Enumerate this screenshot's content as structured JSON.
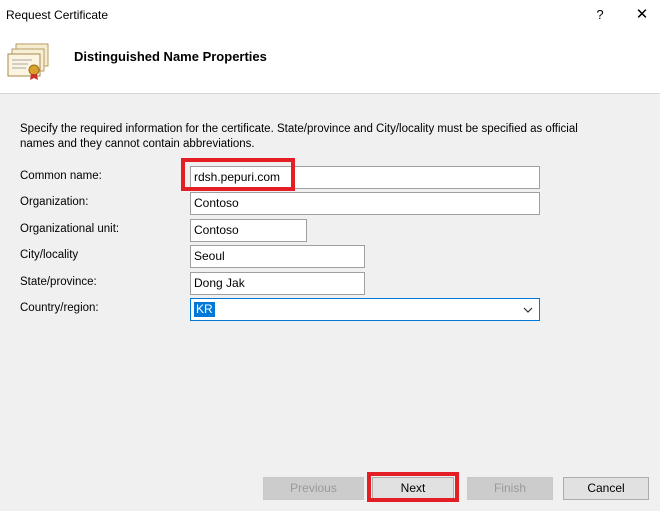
{
  "window": {
    "title": "Request Certificate",
    "help_glyph": "?",
    "close_glyph": "✕"
  },
  "header": {
    "title": "Distinguished Name Properties",
    "icon": "certificate-icon"
  },
  "description": "Specify the required information for the certificate. State/province and City/locality must be specified as official names and they cannot contain abbreviations.",
  "form": {
    "common_name": {
      "label": "Common name:",
      "value": "rdsh.pepuri.com"
    },
    "organization": {
      "label": "Organization:",
      "value": "Contoso"
    },
    "organizational_unit": {
      "label": "Organizational unit:",
      "value": "Contoso"
    },
    "city": {
      "label": "City/locality",
      "value": "Seoul"
    },
    "state": {
      "label": "State/province:",
      "value": "Dong Jak"
    },
    "country": {
      "label": "Country/region:",
      "value": "KR"
    }
  },
  "buttons": {
    "previous": "Previous",
    "next": "Next",
    "finish": "Finish",
    "cancel": "Cancel"
  },
  "colors": {
    "highlight": "#e31e24",
    "selection": "#0078d7"
  }
}
